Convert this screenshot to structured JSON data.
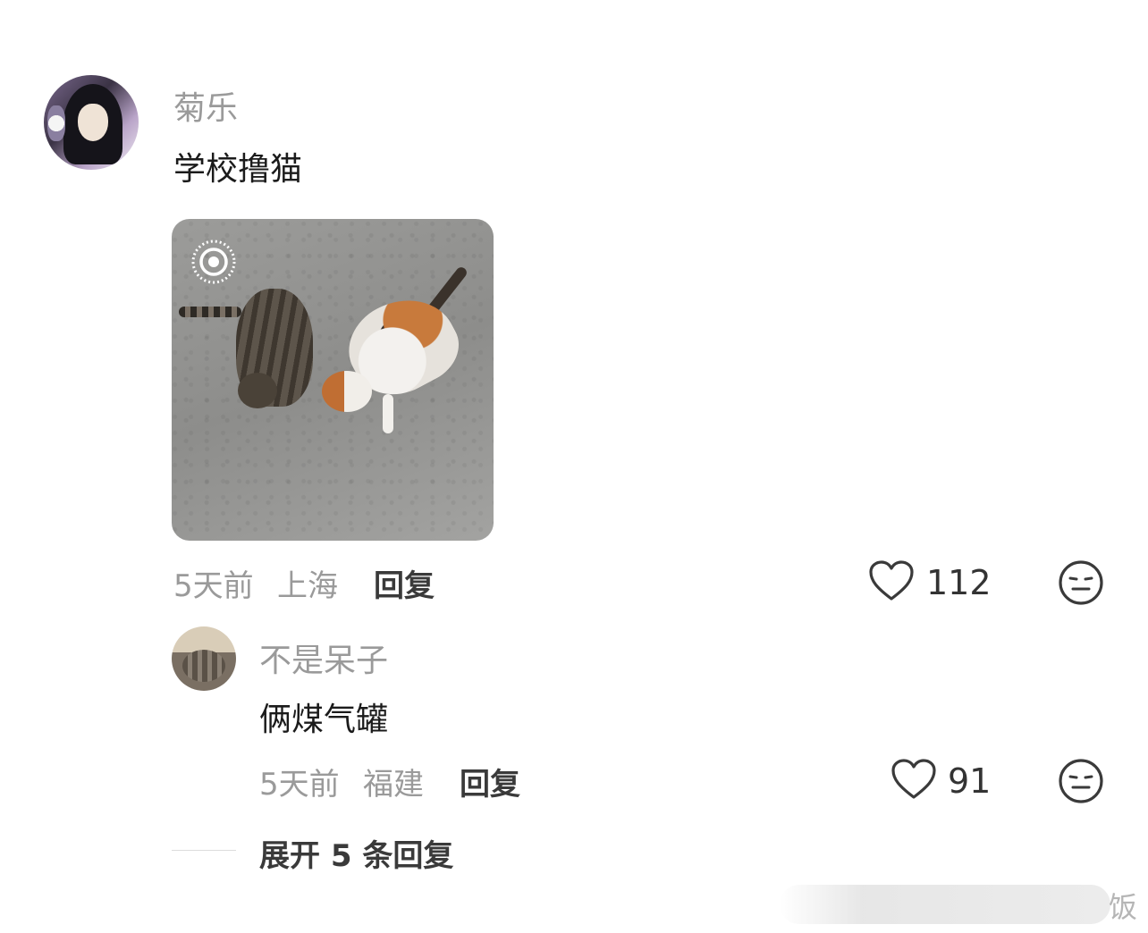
{
  "comment": {
    "username": "菊乐",
    "text": "学校撸猫",
    "time": "5天前",
    "location": "上海",
    "reply_label": "回复",
    "likes": "112"
  },
  "reply": {
    "username": "不是呆子",
    "text": "俩煤气罐",
    "time": "5天前",
    "location": "福建",
    "reply_label": "回复",
    "likes": "91"
  },
  "expand_replies_label": "展开 5 条回复",
  "watermark": "饭",
  "icons": {
    "like": "heart-outline-icon",
    "dislike": "meh-face-icon",
    "live_photo": "live-photo-icon"
  }
}
